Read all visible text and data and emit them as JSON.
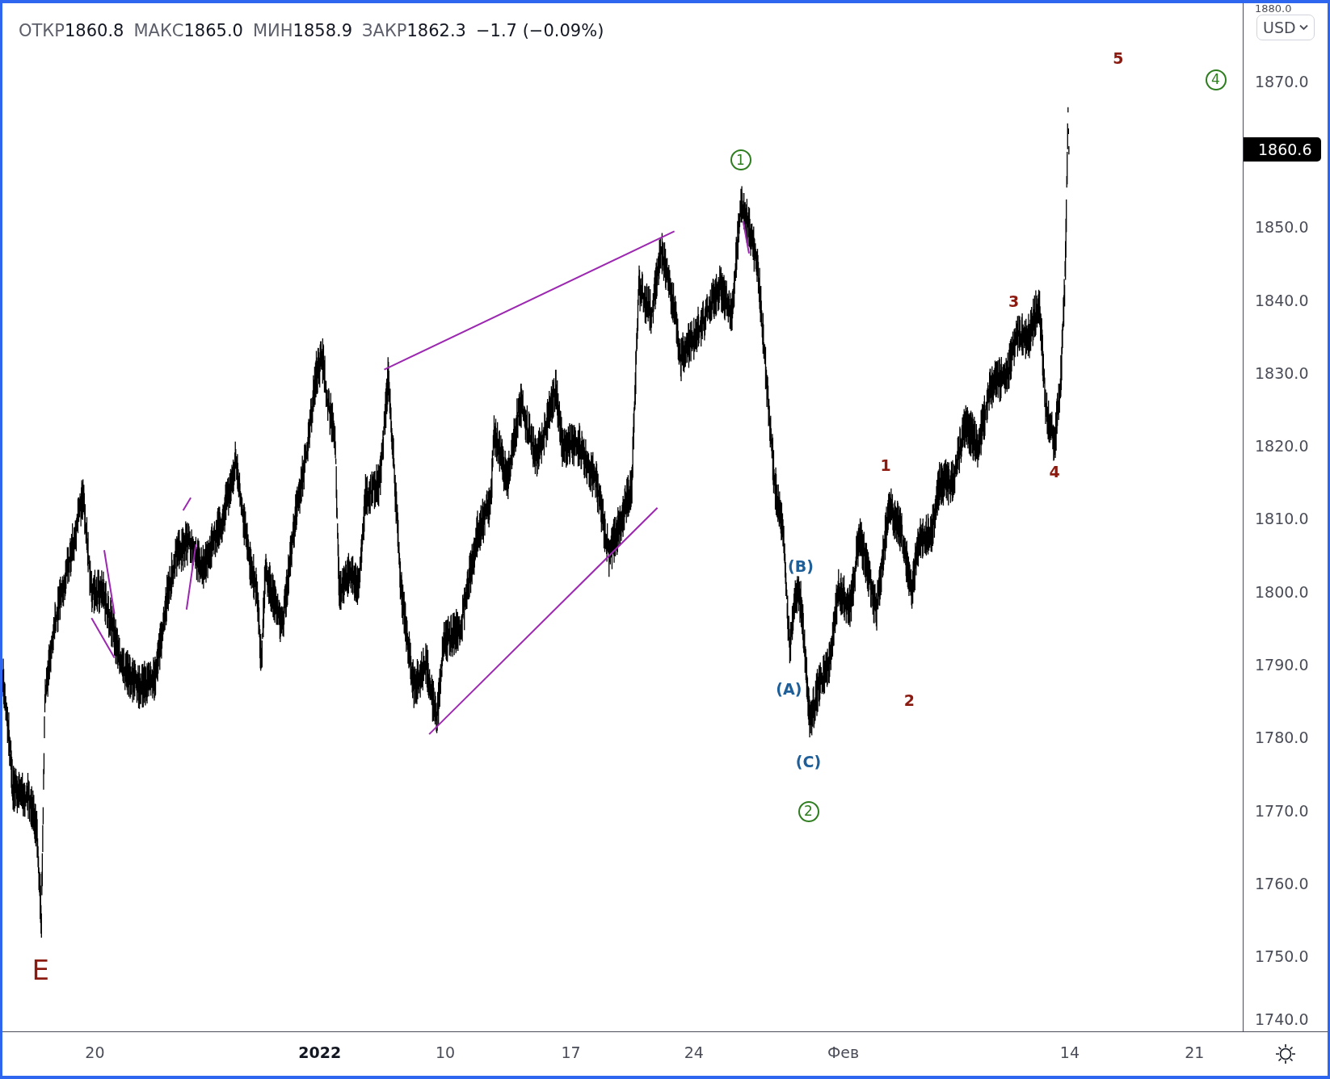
{
  "legend": {
    "items": [
      {
        "label": "ОТКР",
        "value": "1860.8"
      },
      {
        "label": "МАКС",
        "value": "1865.0"
      },
      {
        "label": "МИН",
        "value": "1858.9"
      },
      {
        "label": "ЗАКР",
        "value": "1862.3"
      }
    ],
    "change": "−1.7 (−0.09%)"
  },
  "currency_button": "USD",
  "price_axis": {
    "labels": [
      "1880.0",
      "1870.0",
      "1850.0",
      "1840.0",
      "1830.0",
      "1820.0",
      "1810.0",
      "1800.0",
      "1790.0",
      "1780.0",
      "1770.0",
      "1760.0",
      "1750.0",
      "1740.0"
    ],
    "current_price": "1860.6"
  },
  "time_axis": {
    "labels": [
      {
        "text": "20",
        "bold": false
      },
      {
        "text": "2022",
        "bold": true
      },
      {
        "text": "10",
        "bold": false
      },
      {
        "text": "17",
        "bold": false
      },
      {
        "text": "24",
        "bold": false
      },
      {
        "text": "Фев",
        "bold": false
      },
      {
        "text": "14",
        "bold": false
      },
      {
        "text": "21",
        "bold": false
      }
    ]
  },
  "wave_labels": [
    {
      "text": "5",
      "kind": "number",
      "color": "#8b1a10"
    },
    {
      "text": "4",
      "kind": "circled",
      "color": "#2e7d1f"
    },
    {
      "text": "1",
      "kind": "circled",
      "color": "#2e7d1f"
    },
    {
      "text": "3",
      "kind": "number",
      "color": "#8b1a10"
    },
    {
      "text": "1",
      "kind": "number",
      "color": "#8b1a10"
    },
    {
      "text": "4",
      "kind": "number",
      "color": "#8b1a10"
    },
    {
      "text": "(B)",
      "kind": "paren",
      "color": "#1f5f99"
    },
    {
      "text": "(A)",
      "kind": "paren",
      "color": "#1f5f99"
    },
    {
      "text": "2",
      "kind": "number",
      "color": "#8b1a10"
    },
    {
      "text": "(C)",
      "kind": "paren",
      "color": "#1f5f99"
    },
    {
      "text": "2",
      "kind": "circled",
      "color": "#2e7d1f"
    },
    {
      "text": "E",
      "kind": "letter",
      "color": "#8b1a10"
    }
  ]
}
